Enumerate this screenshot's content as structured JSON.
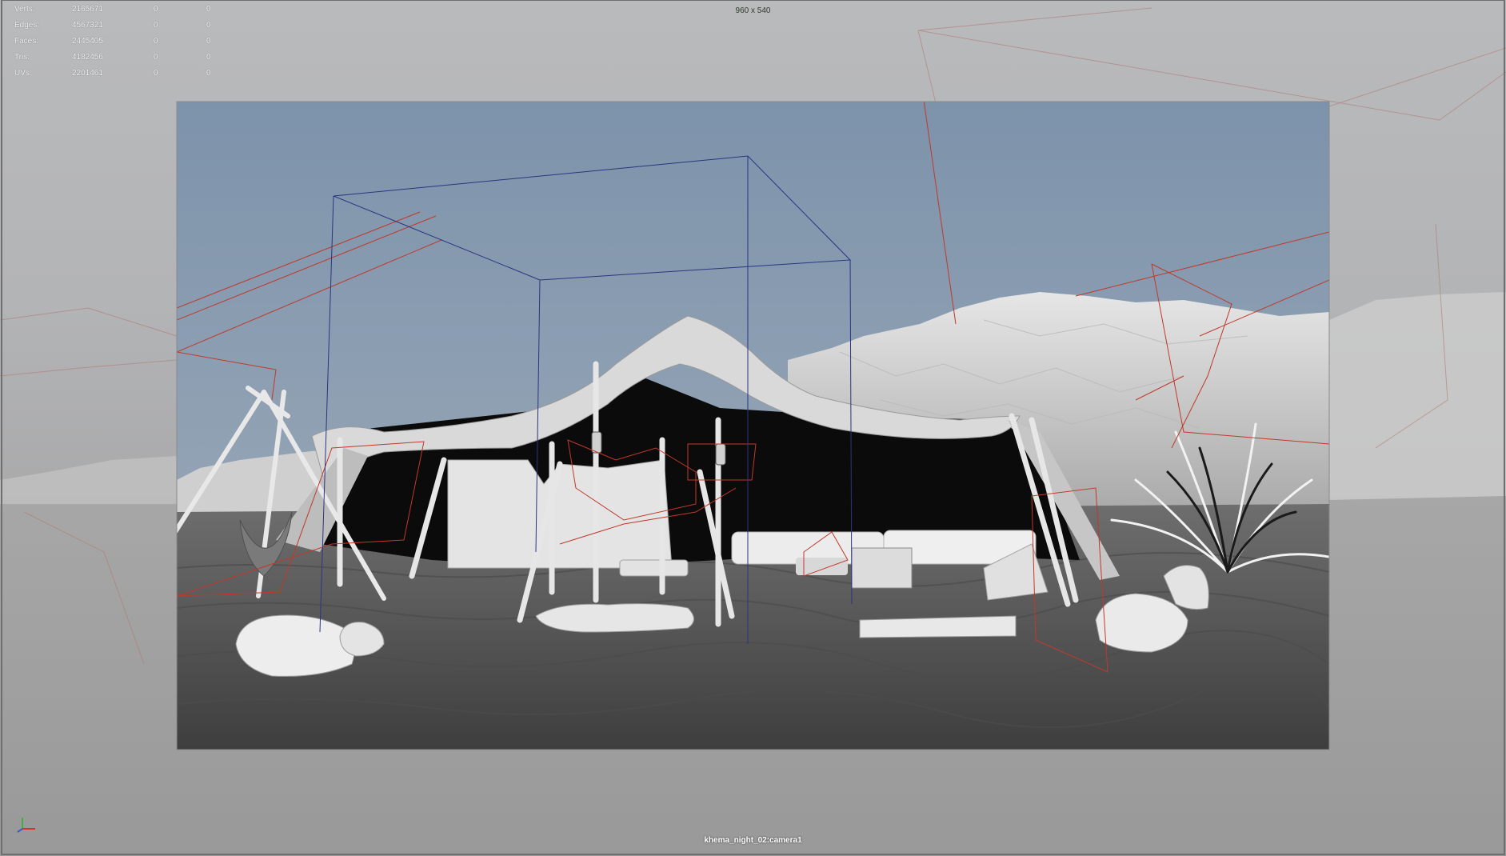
{
  "viewport": {
    "stats": [
      {
        "label": "Verts:",
        "value": "2165671",
        "c1": "0",
        "c2": "0"
      },
      {
        "label": "Edges:",
        "value": "4567321",
        "c1": "0",
        "c2": "0"
      },
      {
        "label": "Faces:",
        "value": "2445405",
        "c1": "0",
        "c2": "0"
      },
      {
        "label": "Tris:",
        "value": "4182456",
        "c1": "0",
        "c2": "0"
      },
      {
        "label": "UVs:",
        "value": "2201461",
        "c1": "0",
        "c2": "0"
      }
    ],
    "resolution_gate": "960 x 540",
    "camera_name": "khema_night_02:camera1",
    "icons": {
      "axis": "xyz-axis-gizmo-icon"
    },
    "colors": {
      "viewport_bg": "#b5b6b8",
      "sky_top": "#7f95ad",
      "sky_bottom": "#9aa9b8",
      "ground": "#5a5a5a",
      "light_gizmo": "#c0392b",
      "bbox_gizmo": "#2a3580",
      "tent_shadow": "#0b0b0b"
    }
  }
}
